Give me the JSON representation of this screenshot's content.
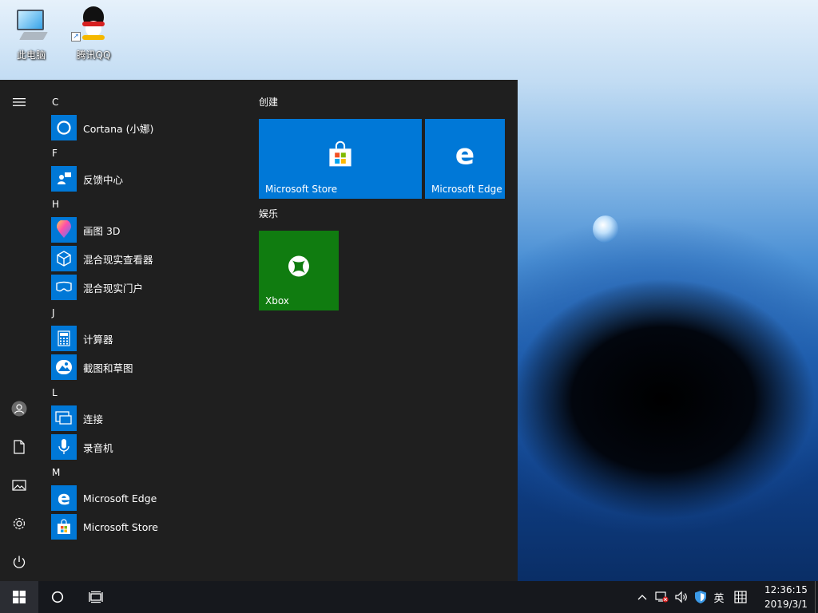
{
  "desktop": {
    "icons": [
      {
        "label": "此电脑",
        "icon": "this-pc-icon"
      },
      {
        "label": "腾讯QQ",
        "icon": "qq-penguin-icon"
      }
    ]
  },
  "start_menu": {
    "rail": {
      "menu_icon": "hamburger-icon",
      "account_icon": "user-avatar-icon",
      "documents_icon": "document-icon",
      "pictures_icon": "pictures-icon",
      "settings_icon": "gear-icon",
      "power_icon": "power-icon"
    },
    "groups": [
      {
        "letter": "C",
        "apps": [
          {
            "label": "Cortana (小娜)",
            "icon": "cortana-icon"
          }
        ]
      },
      {
        "letter": "F",
        "apps": [
          {
            "label": "反馈中心",
            "icon": "feedback-hub-icon"
          }
        ]
      },
      {
        "letter": "H",
        "apps": [
          {
            "label": "画图 3D",
            "icon": "paint-3d-icon"
          },
          {
            "label": "混合现实查看器",
            "icon": "mixed-reality-viewer-icon"
          },
          {
            "label": "混合现实门户",
            "icon": "mixed-reality-portal-icon"
          }
        ]
      },
      {
        "letter": "J",
        "apps": [
          {
            "label": "计算器",
            "icon": "calculator-icon"
          },
          {
            "label": "截图和草图",
            "icon": "snip-sketch-icon"
          }
        ]
      },
      {
        "letter": "L",
        "apps": [
          {
            "label": "连接",
            "icon": "connect-icon"
          },
          {
            "label": "录音机",
            "icon": "voice-recorder-icon"
          }
        ]
      },
      {
        "letter": "M",
        "apps": [
          {
            "label": "Microsoft Edge",
            "icon": "edge-icon"
          },
          {
            "label": "Microsoft Store",
            "icon": "store-icon"
          }
        ]
      }
    ],
    "tile_groups": [
      {
        "title": "创建",
        "tiles": [
          {
            "label": "Microsoft Store",
            "icon": "store-icon",
            "color": "#0078d7"
          },
          {
            "label": "Microsoft Edge",
            "icon": "edge-icon",
            "color": "#0078d7"
          }
        ]
      },
      {
        "title": "娱乐",
        "tiles": [
          {
            "label": "Xbox",
            "icon": "xbox-icon",
            "color": "#107c10"
          }
        ]
      }
    ]
  },
  "taskbar": {
    "start_icon": "windows-logo-icon",
    "search_icon": "cortana-circle-icon",
    "task_view_icon": "task-view-icon",
    "tray": {
      "chevron_icon": "chevron-up-icon",
      "network_icon": "network-disconnected-icon",
      "volume_icon": "volume-icon",
      "security_icon": "windows-defender-icon",
      "ime_label": "英",
      "ime_grid_icon": "ime-grid-icon"
    },
    "clock": {
      "time": "12:36:15",
      "date": "2019/3/1"
    }
  },
  "colors": {
    "accent": "#0078d7",
    "xbox": "#107c10",
    "start_bg": "#1f1f1f",
    "taskbar_bg": "#16181d"
  }
}
